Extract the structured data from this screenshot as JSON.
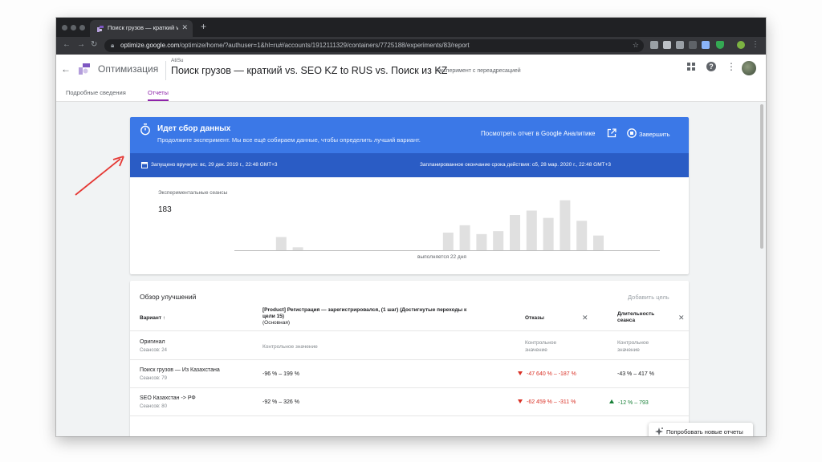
{
  "browser": {
    "tab_title": "Поиск грузов — краткий vs. SE",
    "url_host": "optimize.google.com",
    "url_path": "/optimize/home/?authuser=1&hl=ru#/accounts/1912111329/containers/7725188/experiments/83/report",
    "new_tab_icon": "plus-icon",
    "colors": {
      "tabstrip": "#202124",
      "toolbar": "#35363a"
    }
  },
  "app": {
    "brand": "Оптимизация",
    "container": "AtiSu",
    "experiment_title": "Поиск грузов — краткий vs. SEO KZ to RUS vs. Поиск из KZ",
    "experiment_type": "Эксперимент с переадресацией",
    "tabs": [
      {
        "label": "Подробные сведения"
      },
      {
        "label": "Отчеты",
        "active": true
      }
    ],
    "accent_color": "#8e24aa"
  },
  "status": {
    "title": "Идет сбор данных",
    "subtitle": "Продолжите эксперимент. Мы все ещё собираем данные, чтобы определить лучший вариант.",
    "report_link": "Посмотреть отчет в Google Аналитике",
    "finish_label": "Завершить",
    "started": "Запущено вручную: вс, 29 дек. 2019 г., 22:48 GMT+3",
    "planned_end": "Запланированное окончание срока действия: сб, 28 мар. 2020 г., 22:48 GMT+3",
    "sessions_label": "Экспериментальные сеансы",
    "sessions_value": "183",
    "running": "выполняется 22 дня",
    "colors": {
      "header": "#3b78e7",
      "band": "#2a5cc5"
    }
  },
  "chart_data": {
    "type": "bar",
    "title": "",
    "xlabel": "",
    "ylabel": "",
    "values": [
      0,
      9,
      2,
      0,
      0,
      0,
      0,
      0,
      0,
      0,
      0,
      12,
      17,
      11,
      13,
      0,
      0,
      0,
      0,
      0,
      0,
      0,
      0,
      0,
      0,
      0,
      0,
      0,
      0,
      0,
      0,
      0,
      0,
      0,
      0,
      0,
      0,
      0,
      0,
      0,
      0,
      0,
      0,
      0,
      0,
      0,
      0,
      0,
      0,
      0,
      0,
      0,
      0,
      0,
      0,
      0,
      0,
      0,
      0,
      0,
      0,
      0,
      0,
      0,
      0,
      0,
      0,
      0,
      0,
      0,
      0,
      0,
      0,
      0,
      0,
      0,
      0,
      0,
      0,
      0,
      0,
      0,
      0,
      0,
      0,
      0,
      0,
      0,
      0,
      0,
      0,
      0,
      0,
      0,
      0,
      0,
      0,
      0,
      0,
      0,
      0,
      0,
      0,
      0,
      0,
      0,
      0,
      0,
      0,
      0,
      0,
      0,
      0,
      0,
      0,
      0,
      0,
      0,
      0,
      0,
      0,
      0,
      0,
      0,
      0,
      0,
      0,
      0,
      0,
      0,
      0,
      0,
      0,
      0,
      0,
      0,
      0,
      0,
      0,
      0,
      0,
      0,
      0,
      0,
      0,
      0,
      0,
      0,
      0,
      0,
      0,
      0,
      0,
      0,
      0,
      0,
      0,
      0,
      0,
      0,
      0,
      0,
      0,
      0,
      0,
      0,
      0,
      0,
      0,
      0,
      0,
      0,
      0,
      0,
      0,
      0,
      0,
      0,
      0,
      0,
      0,
      0,
      0,
      0,
      0,
      0,
      0,
      0,
      0,
      0,
      0,
      0,
      0,
      0,
      0,
      0,
      0,
      0,
      0,
      0,
      0,
      0,
      0,
      0,
      0,
      0,
      0,
      0,
      0,
      0,
      0,
      0,
      0,
      0,
      0,
      0,
      0,
      0,
      0,
      0,
      0,
      0,
      0,
      0,
      0,
      0,
      0,
      0,
      0,
      0,
      0,
      0,
      0,
      0,
      0,
      0,
      0,
      0,
      0,
      0,
      0,
      0,
      0,
      0,
      0,
      0,
      0,
      0,
      0,
      0,
      0,
      0,
      0,
      0,
      0,
      0,
      0,
      0,
      0,
      0
    ],
    "ylim": [
      0,
      36
    ],
    "grid": false,
    "bar_color": "#e0e0e0"
  },
  "improvements": {
    "title": "Обзор улучшений",
    "add_goal": "Добавить цель",
    "col_variant": "Вариант ↑",
    "col_goal": "[Product] Регистрация — зарегистрировался, (1 шаг) (Достигнутые переходы к цели 15)",
    "col_goal_sub": "(Основная)",
    "col_bounces": "Отказы",
    "col_duration": "Длительность сеанса",
    "rows": [
      {
        "name": "Оригинал",
        "sessions": "Сеансов: 24",
        "goal": "Контрольное значение",
        "bounces": "Контрольное значение",
        "duration": "Контрольное значение"
      },
      {
        "name": "Поиск грузов — Из Казахстана",
        "sessions": "Сеансов: 79",
        "goal": "-96 % – 199 %",
        "bounces": "-47 640 % – -187 %",
        "duration": "-43 % – 417 %"
      },
      {
        "name": "SEO Казахстан -> РФ",
        "sessions": "Сеансов: 80",
        "goal": "-92 % – 326 %",
        "bounces": "-62 459 % – -311 %",
        "duration": "-12 % – 793"
      }
    ]
  },
  "try_reports": "Попробовать новые отчеты"
}
